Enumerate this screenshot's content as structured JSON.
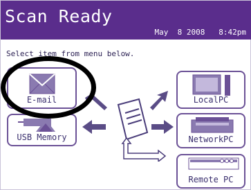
{
  "screen": {
    "title": "Scan Ready",
    "datetime": "May  8 2008   8:42pm",
    "instruction": "Select item from menu below."
  },
  "buttons": {
    "email": "E-mail",
    "usb": "USB Memory",
    "local": "LocalPC",
    "network": "NetworkPC",
    "remote": "Remote PC"
  },
  "colors": {
    "title_bar": "#5a2d8c",
    "button_border": "#6b5196",
    "label_text": "#3a2f6e",
    "highlight_circle": "#000000"
  }
}
